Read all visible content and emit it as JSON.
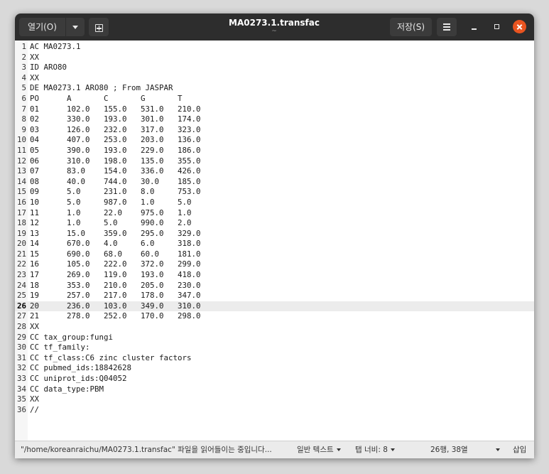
{
  "header": {
    "open_label": "열기(O)",
    "save_label": "저장(S)",
    "title": "MA0273.1.transfac",
    "subtitle": "~"
  },
  "editor": {
    "current_line": 26,
    "lines": [
      {
        "n": "1",
        "text": "AC MA0273.1"
      },
      {
        "n": "2",
        "text": "XX"
      },
      {
        "n": "3",
        "text": "ID ARO80"
      },
      {
        "n": "4",
        "text": "XX"
      },
      {
        "n": "5",
        "text": "DE MA0273.1 ARO80 ; From JASPAR"
      },
      {
        "n": "6",
        "text": "PO      A       C       G       T"
      },
      {
        "n": "7",
        "text": "01      102.0   155.0   531.0   210.0"
      },
      {
        "n": "8",
        "text": "02      330.0   193.0   301.0   174.0"
      },
      {
        "n": "9",
        "text": "03      126.0   232.0   317.0   323.0"
      },
      {
        "n": "10",
        "text": "04      407.0   253.0   203.0   136.0"
      },
      {
        "n": "11",
        "text": "05      390.0   193.0   229.0   186.0"
      },
      {
        "n": "12",
        "text": "06      310.0   198.0   135.0   355.0"
      },
      {
        "n": "13",
        "text": "07      83.0    154.0   336.0   426.0"
      },
      {
        "n": "14",
        "text": "08      40.0    744.0   30.0    185.0"
      },
      {
        "n": "15",
        "text": "09      5.0     231.0   8.0     753.0"
      },
      {
        "n": "16",
        "text": "10      5.0     987.0   1.0     5.0"
      },
      {
        "n": "17",
        "text": "11      1.0     22.0    975.0   1.0"
      },
      {
        "n": "18",
        "text": "12      1.0     5.0     990.0   2.0"
      },
      {
        "n": "19",
        "text": "13      15.0    359.0   295.0   329.0"
      },
      {
        "n": "20",
        "text": "14      670.0   4.0     6.0     318.0"
      },
      {
        "n": "21",
        "text": "15      690.0   68.0    60.0    181.0"
      },
      {
        "n": "22",
        "text": "16      105.0   222.0   372.0   299.0"
      },
      {
        "n": "23",
        "text": "17      269.0   119.0   193.0   418.0"
      },
      {
        "n": "24",
        "text": "18      353.0   210.0   205.0   230.0"
      },
      {
        "n": "25",
        "text": "19      257.0   217.0   178.0   347.0"
      },
      {
        "n": "26",
        "text": "20      236.0   103.0   349.0   310.0"
      },
      {
        "n": "27",
        "text": "21      278.0   252.0   170.0   298.0"
      },
      {
        "n": "28",
        "text": "XX"
      },
      {
        "n": "29",
        "text": "CC tax_group:fungi"
      },
      {
        "n": "30",
        "text": "CC tf_family:"
      },
      {
        "n": "31",
        "text": "CC tf_class:C6 zinc cluster factors"
      },
      {
        "n": "32",
        "text": "CC pubmed_ids:18842628"
      },
      {
        "n": "33",
        "text": "CC uniprot_ids:Q04052"
      },
      {
        "n": "34",
        "text": "CC data_type:PBM"
      },
      {
        "n": "35",
        "text": "XX"
      },
      {
        "n": "36",
        "text": "//"
      }
    ]
  },
  "statusbar": {
    "message": "\"/home/koreanraichu/MA0273.1.transfac\" 파일을 읽어들이는 중입니다...",
    "language": "일반 텍스트",
    "tab_width": "탭 너비: 8",
    "position": "26행, 38열",
    "insert_mode": "삽입"
  },
  "colors": {
    "headerbar": "#2d2d2d",
    "close_button": "#e95420",
    "current_line": "#ececec",
    "statusbar": "#ebebeb"
  }
}
